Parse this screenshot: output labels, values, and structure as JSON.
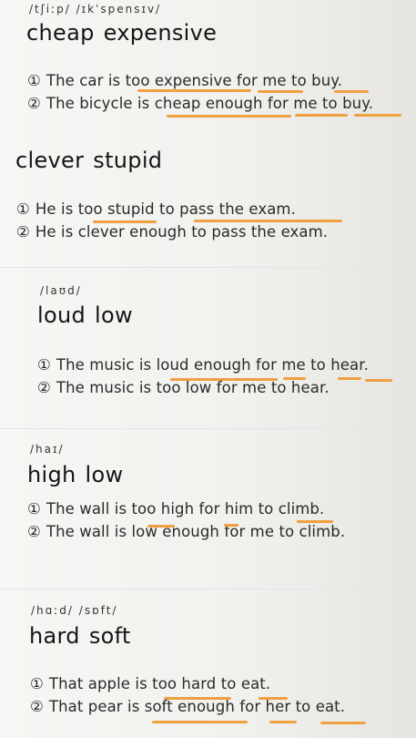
{
  "sections": [
    {
      "phonetic": "/tʃiːp/  /ɪkˈspensɪv/",
      "words": [
        "cheap",
        "expensive"
      ],
      "sentences": [
        {
          "num": "①",
          "text": "The car is too expensive for me to buy."
        },
        {
          "num": "②",
          "text": "The bicycle is cheap enough for me to buy."
        }
      ]
    },
    {
      "phonetic": "",
      "words": [
        "clever",
        "stupid"
      ],
      "sentences": [
        {
          "num": "①",
          "text": "He is too stupid to pass the exam."
        },
        {
          "num": "②",
          "text": "He is clever enough to pass the exam."
        }
      ]
    },
    {
      "phonetic": "/laʊd/",
      "words": [
        "loud",
        "low"
      ],
      "sentences": [
        {
          "num": "①",
          "text": "The music is loud enough for me to hear."
        },
        {
          "num": "②",
          "text": "The music is too low for me to hear."
        }
      ]
    },
    {
      "phonetic": "/haɪ/",
      "words": [
        "high",
        "low"
      ],
      "sentences": [
        {
          "num": "①",
          "text": "The wall is too high for him to climb."
        },
        {
          "num": "②",
          "text": "The wall is low enough for me to climb."
        }
      ]
    },
    {
      "phonetic": "/hɑːd/  /sɒft/",
      "words": [
        "hard",
        "soft"
      ],
      "sentences": [
        {
          "num": "①",
          "text": "That apple is too hard to eat."
        },
        {
          "num": "②",
          "text": "That pear is soft enough for her to eat."
        }
      ]
    }
  ],
  "colors": {
    "underline": "#f0a040",
    "text": "#2a2a2a",
    "divider": "#dde6ee"
  }
}
